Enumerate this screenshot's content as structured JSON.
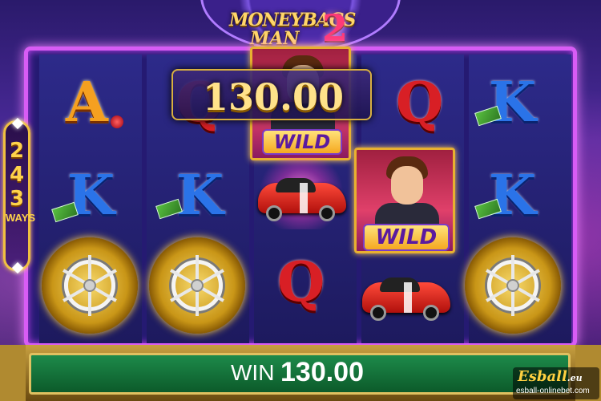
{
  "game": {
    "title_line1": "MONEYBAGS",
    "title_line2": "MAN",
    "title_number": "2",
    "ways_digits": "243",
    "ways_label": "WAYS"
  },
  "reels": [
    {
      "reel": 1,
      "symbols": [
        "A",
        "K",
        "vault"
      ]
    },
    {
      "reel": 2,
      "symbols": [
        "Q",
        "K",
        "vault"
      ]
    },
    {
      "reel": 3,
      "symbols": [
        "wild",
        "car",
        "Q"
      ]
    },
    {
      "reel": 4,
      "symbols": [
        "Q",
        "wild",
        "car"
      ]
    },
    {
      "reel": 5,
      "symbols": [
        "K",
        "K",
        "vault"
      ]
    }
  ],
  "symbol_text": {
    "a": "A",
    "q": "Q",
    "k": "K",
    "wild": "WILD"
  },
  "win_popup": "130.00",
  "win_bar": {
    "label": "WIN",
    "value": "130.00"
  },
  "watermark": {
    "brand": "Esball",
    "brand_suffix": ".eu",
    "url": "esball-onlinebet.com"
  },
  "colors": {
    "frame": "#d85cf5",
    "win_bar": "#1d8a4a",
    "gold": "#ffd34a"
  }
}
